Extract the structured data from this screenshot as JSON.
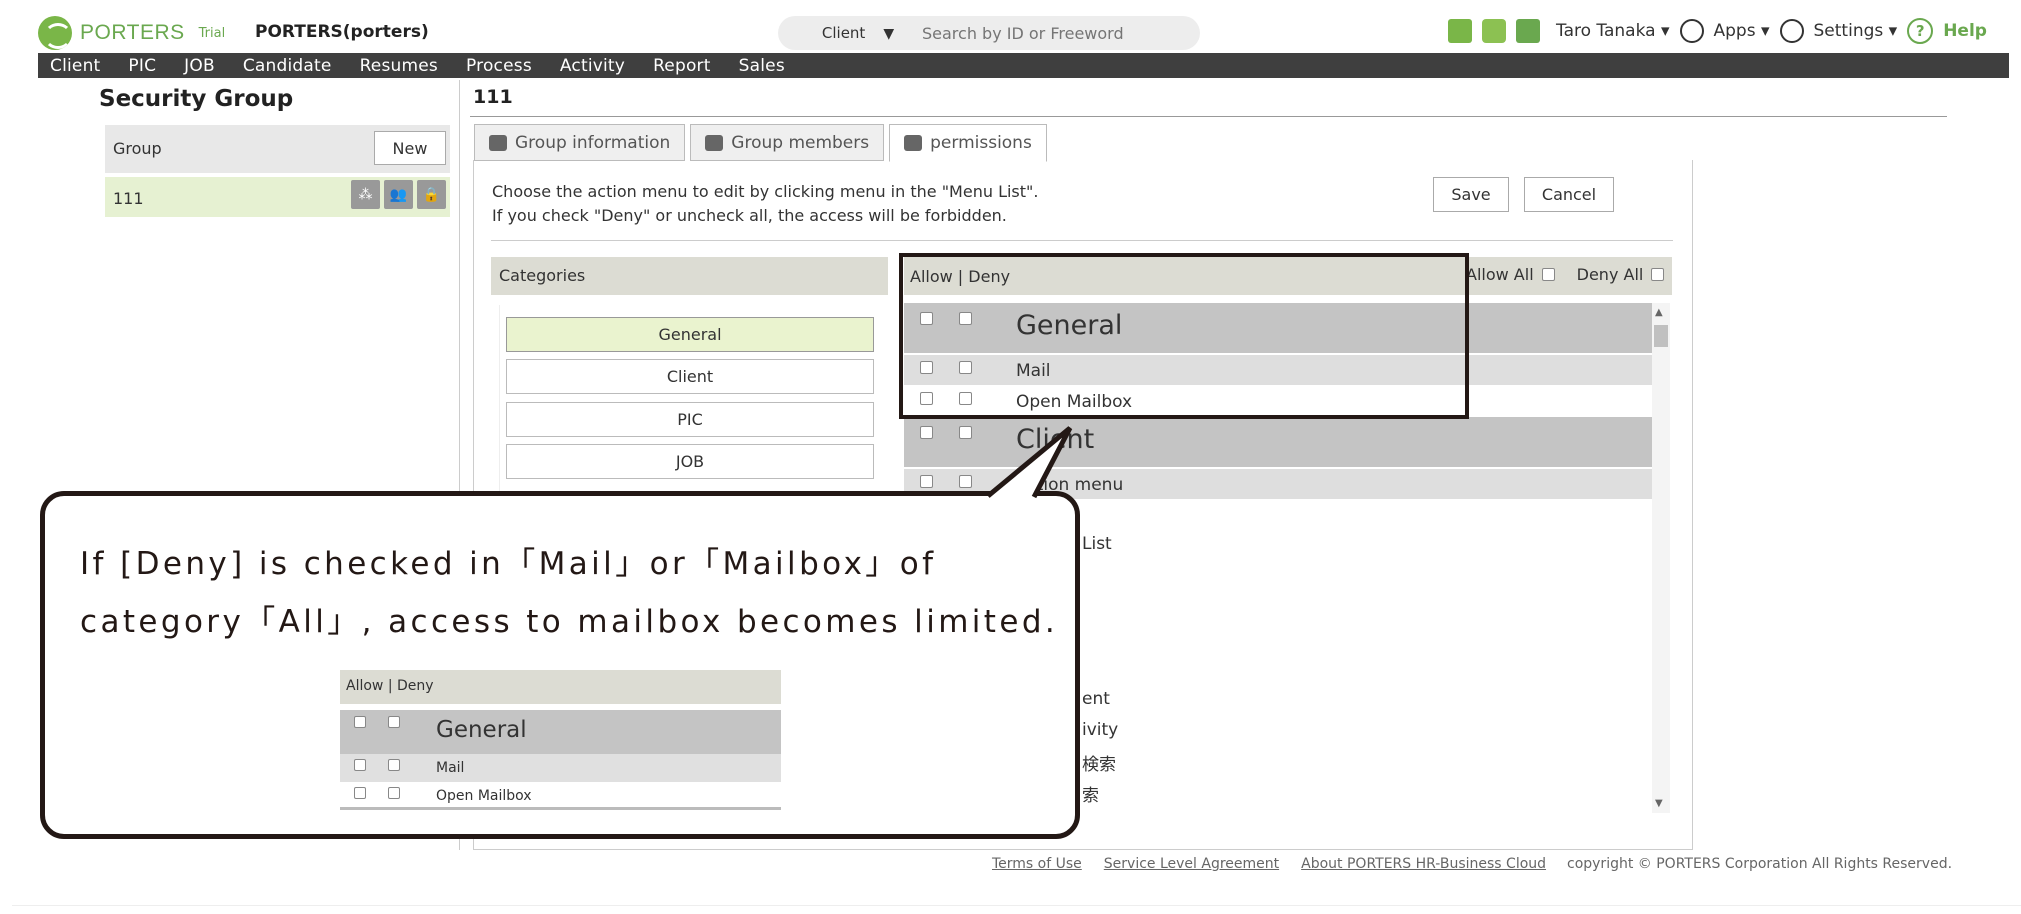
{
  "header": {
    "brand": "PORTERS",
    "trial": "Trial",
    "company": "PORTERS(porters)",
    "search_scope": "Client",
    "search_placeholder": "Search by ID or Freeword",
    "user": "Taro Tanaka ▾",
    "apps": "Apps ▾",
    "settings": "Settings ▾",
    "help": "Help"
  },
  "nav": [
    "Client",
    "PIC",
    "JOB",
    "Candidate",
    "Resumes",
    "Process",
    "Activity",
    "Report",
    "Sales"
  ],
  "left": {
    "title": "Security Group",
    "group_label": "Group",
    "new_label": "New",
    "group_row": "111"
  },
  "main": {
    "title": "111",
    "tabs": [
      "Group information",
      "Group members",
      "permissions"
    ],
    "instruction_1": "Choose the action menu to edit by clicking menu in the \"Menu List\".",
    "instruction_2": "If you check \"Deny\" or uncheck all, the access will be forbidden.",
    "save": "Save",
    "cancel": "Cancel",
    "categories_label": "Categories",
    "categories": [
      "General",
      "Client",
      "PIC",
      "JOB"
    ],
    "allow_deny": "Allow | Deny",
    "allow_all": "Allow All",
    "deny_all": "Deny All",
    "perm_rows": [
      {
        "type": "group",
        "label": "General"
      },
      {
        "type": "menu",
        "label": "Mail"
      },
      {
        "type": "plain",
        "label": "Open Mailbox"
      },
      {
        "type": "group",
        "label": "Client"
      },
      {
        "type": "menu",
        "label": "Action menu"
      }
    ],
    "fragments": [
      "List",
      "ent",
      "ivity",
      "検索",
      "索"
    ]
  },
  "callout": {
    "line1": "If [Deny] is checked in「Mail」or「Mailbox」of",
    "line2": "category「All」, access to mailbox becomes limited.",
    "mini_head": "Allow | Deny",
    "mini_group": "General",
    "mini_menu": "Mail",
    "mini_plain": "Open Mailbox"
  },
  "footer": {
    "links": [
      "Terms of Use",
      "Service Level Agreement",
      "About PORTERS HR-Business Cloud"
    ],
    "copyright": "copyright © PORTERS Corporation All Rights Reserved."
  }
}
